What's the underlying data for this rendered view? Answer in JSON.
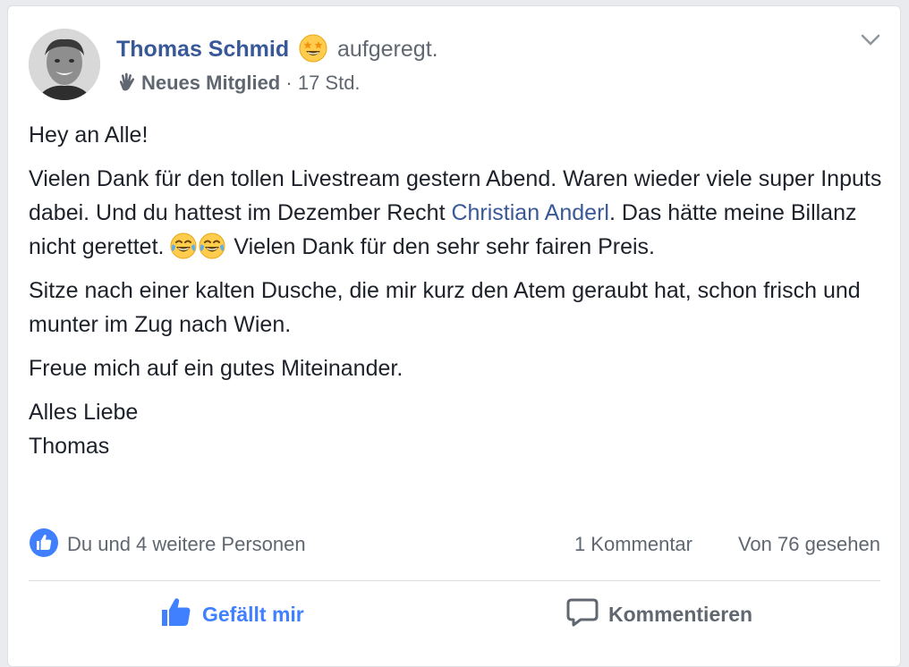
{
  "post": {
    "author": "Thomas Schmid",
    "feeling_icon": "star-struck-emoji-icon",
    "feeling": "aufgeregt.",
    "badge": "Neues Mitglied",
    "separator": "·",
    "time": "17 Std.",
    "paragraphs": {
      "p1": "Hey an Alle!",
      "p2a": "Vielen Dank für den tollen Livestream gestern Abend. Waren wieder viele super Inputs dabei. Und du hattest im Dezember Recht ",
      "mention": "Christian Anderl",
      "p2b": ". Das hätte meine Billanz nicht gerettet. ",
      "p2c": " Vielen Dank für den sehr sehr fairen Preis.",
      "p3": "Sitze nach einer kalten Dusche, die mir kurz den Atem geraubt hat, schon frisch und munter im Zug nach Wien.",
      "p4": "Freue mich auf ein gutes Miteinander.",
      "p5_line1": "Alles Liebe",
      "p5_line2": "Thomas"
    },
    "inline_emojis": [
      "tears-of-joy-emoji-icon",
      "tears-of-joy-emoji-icon"
    ]
  },
  "stats": {
    "likes": "Du und 4 weitere Personen",
    "comments": "1 Kommentar",
    "seen": "Von 76 gesehen"
  },
  "actions": {
    "like_label": "Gefällt mir",
    "comment_label": "Kommentieren"
  },
  "colors": {
    "link": "#385898",
    "like_active": "#4080ff",
    "secondary_text": "#606770",
    "background": "#e9ebee"
  }
}
